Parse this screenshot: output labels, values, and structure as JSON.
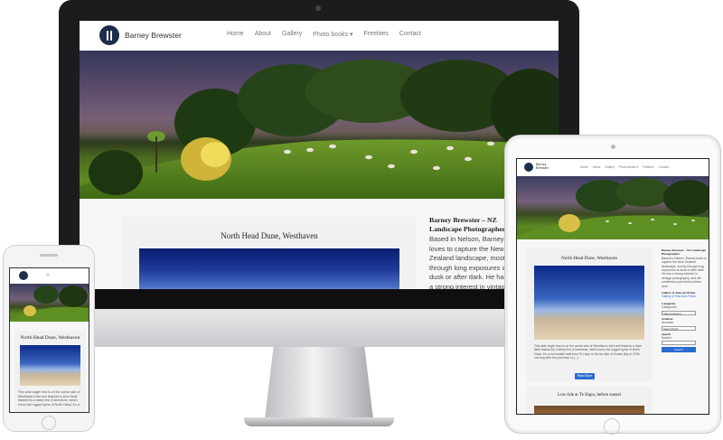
{
  "desktop": {
    "site": {
      "brand": "Barney Brewster",
      "nav": [
        "Home",
        "About",
        "Gallery",
        "Photo books ▾",
        "Freebies",
        "Contact"
      ]
    },
    "card": {
      "title": "North Head Dune, Westhaven"
    },
    "sidebar": {
      "title": "Barney Brewster – NZ Landscape Photographer",
      "bio": "Based in Nelson, Barney loves to capture the New Zealand landscape, mostly through long exposures at dusk or after dark. He has a strong interest in vintage photography, and will"
    }
  },
  "tablet": {
    "site": {
      "brand": "Barney Brewster",
      "nav": [
        "Home",
        "About",
        "Gallery",
        "Photo books ▾",
        "Freebies",
        "Contact"
      ]
    },
    "card": {
      "title": "North Head Dune, Westhaven",
      "excerpt": "This wide angle view is on the ocean side of Westhaven Inlet and features a dune flank backed by a steep line of limestone, which forms the rugged spine of North Head. It's a memorable walk from Te Hapu to the far side of Golden Bay in 2006, not long after the purchase of […]",
      "button": "Read More"
    },
    "card2": {
      "title": "Low tide at Te Hapu, before sunset"
    },
    "sidebar": {
      "title": "Barney Brewster – NZ Landscape Photographer",
      "bio": "Based in Nelson, Barney loves to capture the New Zealand landscape, mostly through long exposures at dusk or after dark. He has a strong interest in vintage photography, and will sometimes post weird photos here.",
      "gallery_title": "Gallery & Fine Art Prints",
      "gallery_link": "Gallery & Fine Arts Prints",
      "categories_title": "Categories",
      "categories_label": "Categories",
      "categories_select": "Select Category",
      "archives_title": "Archives",
      "archives_label": "Archives",
      "archives_select": "Select Month",
      "search_title": "Search",
      "search_label": "Search",
      "search_button": "Search"
    }
  },
  "phone": {
    "menu_icon": "≡",
    "card": {
      "title": "North Head Dune, Westhaven",
      "excerpt": "This wide angle view is on the ocean side of Westhaven Inlet and features a dune flank backed by a steep line of limestone, which forms the rugged spine of North Head. It's a"
    }
  },
  "icons": [
    "logo-icon",
    "menu-icon",
    "camera-icon",
    "home-button-icon"
  ],
  "colors": {
    "brand_navy": "#1d2e4a",
    "button_blue": "#2b6cd0",
    "device_black": "#1b1c1e"
  }
}
